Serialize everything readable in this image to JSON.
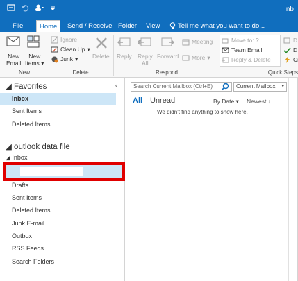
{
  "titlebar": {
    "window_title": "Inb",
    "qat": {
      "sendreceive_icon": "send-receive-all-icon",
      "undo_icon": "undo-icon",
      "customize_icon": "customize-qat-icon"
    }
  },
  "tabs": [
    "File",
    "Home",
    "Send / Receive",
    "Folder",
    "View"
  ],
  "active_tab": "Home",
  "tell_me": "Tell me what you want to do...",
  "ribbon": {
    "new_group": {
      "label": "New",
      "new_email": [
        "New",
        "Email"
      ],
      "new_items": [
        "New",
        "Items"
      ]
    },
    "delete_group": {
      "label": "Delete",
      "ignore": "Ignore",
      "clean_up": "Clean Up",
      "junk": "Junk",
      "delete": "Delete"
    },
    "respond_group": {
      "label": "Respond",
      "reply": "Reply",
      "reply_all": [
        "Reply",
        "All"
      ],
      "forward": "Forward",
      "meeting": "Meeting",
      "more": "More"
    },
    "quicksteps_group": {
      "label": "Quick Steps",
      "move_to": "Move to: ?",
      "team_email": "Team Email",
      "reply_delete": "Reply & Delete",
      "d1": "D",
      "d2": "D",
      "c1": "Cr"
    }
  },
  "leftpane": {
    "favorites_header": "Favorites",
    "favorites": [
      "Inbox",
      "Sent Items",
      "Deleted Items"
    ],
    "account_header": "outlook data file",
    "inbox_header": "Inbox",
    "folders": [
      "Drafts",
      "Sent Items",
      "Deleted Items",
      "Junk E-mail",
      "Outbox",
      "RSS Feeds",
      "Search Folders"
    ]
  },
  "mainpane": {
    "search_placeholder": "Search Current Mailbox (Ctrl+E)",
    "scope": "Current Mailbox",
    "filter_all": "All",
    "filter_unread": "Unread",
    "sort_by": "By Date",
    "sort_dir": "Newest",
    "empty_message": "We didn't find anything to show here."
  },
  "colors": {
    "accent": "#106ebe",
    "selection": "#cde6f7",
    "highlight_box": "#e00000"
  }
}
